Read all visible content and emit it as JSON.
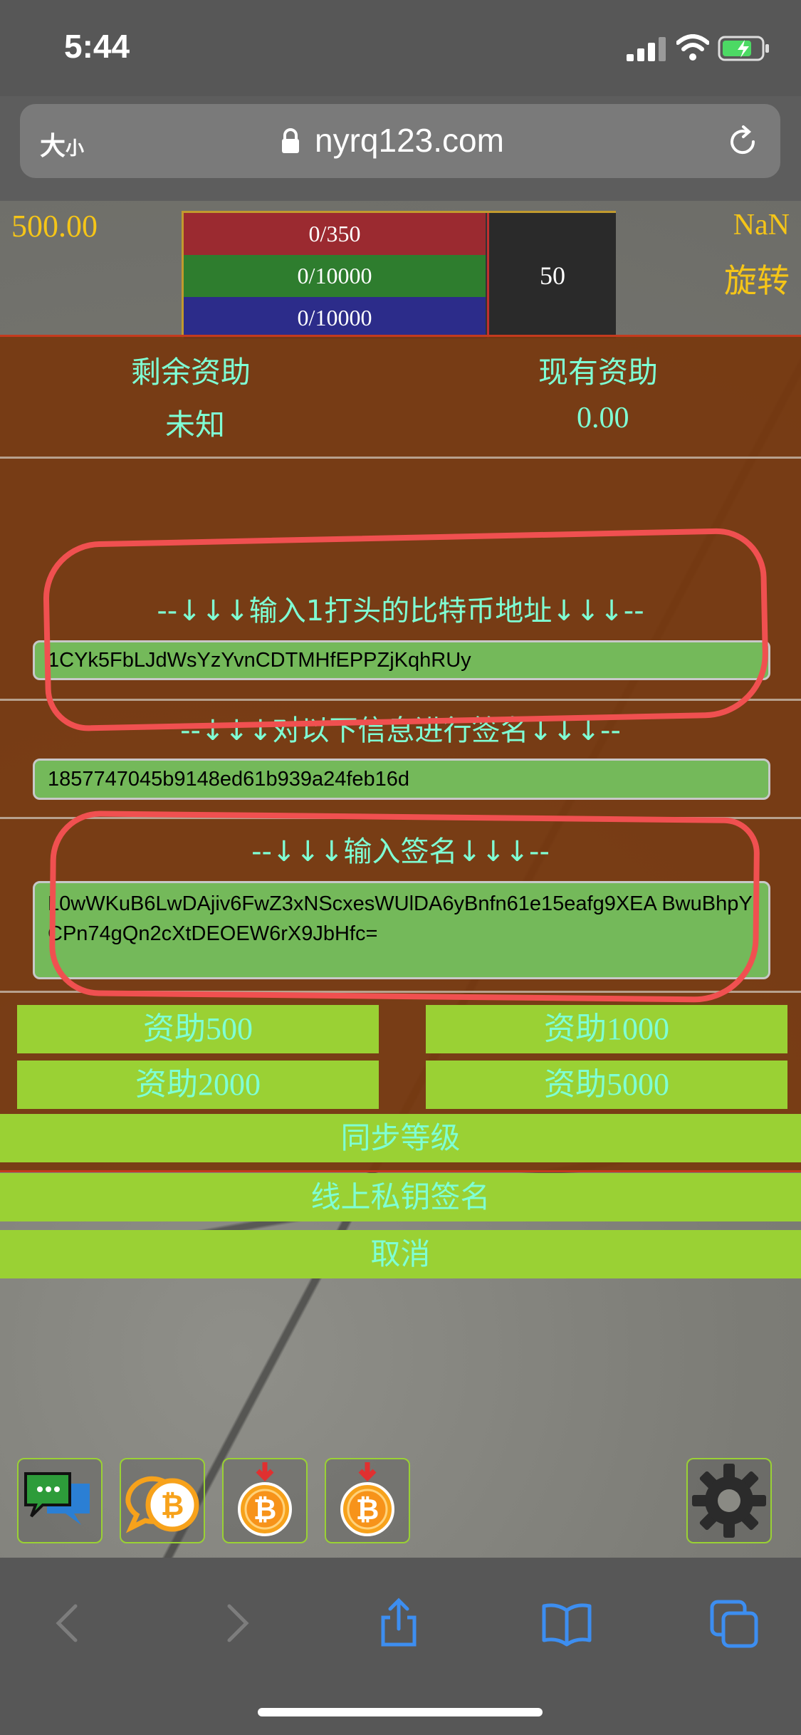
{
  "status": {
    "time": "5:44"
  },
  "browser": {
    "text_size_label_big": "大",
    "text_size_label_small": "小",
    "url": "nyrq123.com"
  },
  "game": {
    "balance": "500.00",
    "nan_label": "NaN",
    "rotate_label": "旋转",
    "bars": {
      "hp": "0/350",
      "green": "0/10000",
      "blue": "0/10000"
    },
    "level": "50"
  },
  "panel": {
    "remaining_label": "剩余资助",
    "current_label": "现有资助",
    "remaining_value": "未知",
    "current_value": "0.00",
    "address_title": "--↓↓↓输入1打头的比特币地址↓↓↓--",
    "address_value": "1CYk5FbLJdWsYzYvnCDTMHfEPPZjKqhRUy",
    "message_title": "--↓↓↓对以下信息进行签名↓↓↓--",
    "message_value": "1857747045b9148ed61b939a24feb16d",
    "signature_title": "--↓↓↓输入签名↓↓↓--",
    "signature_value": "L0wWKuB6LwDAjiv6FwZ3xNScxesWUlDA6yBnfn61e15eafg9XEA BwuBhpYCPn74gQn2cXtDEOEW6rX9JbHfc="
  },
  "buttons": {
    "donate_500": "资助500",
    "donate_1000": "资助1000",
    "donate_2000": "资助2000",
    "donate_5000": "资助5000",
    "sync_level": "同步等级",
    "online_sign": "线上私钥签名",
    "cancel": "取消"
  },
  "icons": [
    "chat-icon",
    "bitcoin-chat-icon",
    "bitcoin-download-icon",
    "bitcoin-download-icon",
    "gear-icon"
  ],
  "colors": {
    "accent_cyan": "#7fffd4",
    "button_green": "#9ad134",
    "panel_brown": "#77380e",
    "annotation_red": "#f05050"
  }
}
